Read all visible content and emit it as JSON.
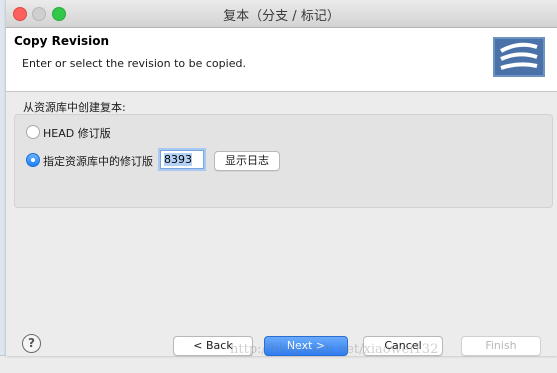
{
  "window": {
    "title": "复本（分支 / 标记）"
  },
  "header": {
    "title": "Copy Revision",
    "description": "Enter or select the revision to be copied."
  },
  "group": {
    "label": "从资源库中创建复本:",
    "options": [
      {
        "label": "HEAD 修订版",
        "selected": false
      },
      {
        "label": "指定资源库中的修订版",
        "selected": true
      }
    ],
    "revision_value": "8393",
    "show_log_label": "显示日志"
  },
  "footer": {
    "help": "?",
    "back_label": "< Back",
    "next_label": "Next >",
    "cancel_label": "Cancel",
    "finish_label": "Finish"
  },
  "watermark": "http://blog.csdn.net/xiaowei132",
  "colors": {
    "accent": "#2c7ef8",
    "close": "#fc615d",
    "zoom": "#34c84a"
  }
}
